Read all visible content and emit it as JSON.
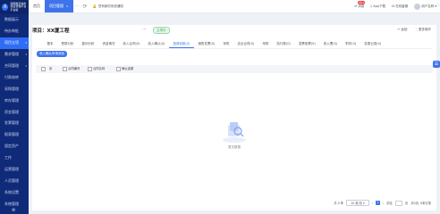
{
  "brand": {
    "logo": "A",
    "name": "海南数字城市建设管理平台",
    "sub": "平台版"
  },
  "sidebar": {
    "items": [
      {
        "label": "数据展示"
      },
      {
        "label": "待办审批"
      },
      {
        "label": "项目立项",
        "caret": "▾"
      },
      {
        "label": "需求管理",
        "caret": "▾"
      },
      {
        "label": "合同管理",
        "caret": "▾"
      },
      {
        "label": "付款结转"
      },
      {
        "label": "采购管理"
      },
      {
        "label": "库存管理"
      },
      {
        "label": "资金管理"
      },
      {
        "label": "发票管理"
      },
      {
        "label": "报表管理"
      },
      {
        "label": "固定资产"
      },
      {
        "label": "工作"
      },
      {
        "label": "运营管理"
      },
      {
        "label": "人员管理"
      },
      {
        "label": "系统设置"
      },
      {
        "label": "系统管理"
      }
    ],
    "active_index": 2
  },
  "topbar": {
    "tabs": [
      {
        "label": "首页"
      },
      {
        "label": "项目管理",
        "close": "×"
      }
    ],
    "notice": "您有新的系统通知",
    "message_label": "消息",
    "message_badge": "99+",
    "app_label": "App下载",
    "help_label": "在线客服",
    "user_label": "用户名称"
  },
  "project": {
    "title": "项目：XX厦工程",
    "status": "立项中",
    "actions": {
      "back": "返回",
      "more": "更多操作"
    }
  },
  "sub_tabs": [
    "基本",
    "预算分析",
    "盈利分析",
    "资金情况",
    "收入合同(0)",
    "收入确认(0)",
    "投资收款(0)",
    "销售发票(0)",
    "采购",
    "支出合同(0)",
    "采购",
    "执行数(0)",
    "发票收票(0)",
    "收入票(0)",
    "附件(0)",
    "变更记录(0)"
  ],
  "active_sub_tab": 6,
  "add_button": "收入确认申请添加",
  "table": {
    "headers": [
      "序",
      "合同编号",
      "合同名称",
      "确认金额"
    ]
  },
  "empty": {
    "text": "暂无数据"
  },
  "pager": {
    "total": "共 0 条",
    "page_size": "10 条/页",
    "prev": "‹",
    "current": "1",
    "next": "›",
    "goto": "前往",
    "page_unit": "页",
    "summary": "共0页, 0条记录"
  }
}
